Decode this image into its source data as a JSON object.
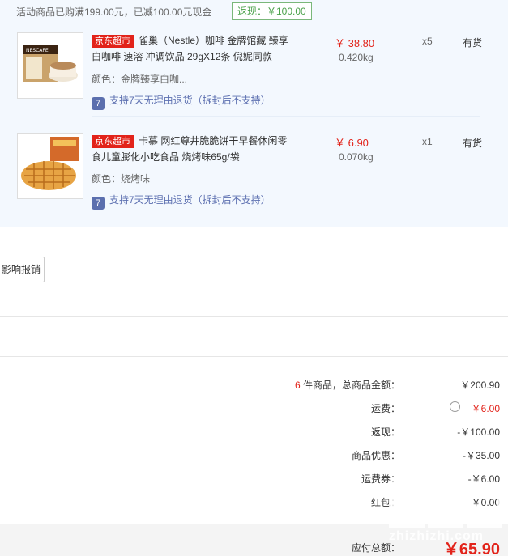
{
  "promo": {
    "text": "活动商品已购满199.00元，已减100.00元现金",
    "cashback": "返现：￥100.00"
  },
  "items": [
    {
      "shop": "京东超市",
      "title": "雀巢（Nestle）咖啡 金牌馆藏 臻享白咖啡 速溶 冲调饮品 29gX12条 倪妮同款",
      "attr": "颜色：金牌臻享白咖...",
      "return_icon": "7",
      "return_text": "支持7天无理由退货（拆封后不支持）",
      "price": "￥ 38.80",
      "weight": "0.420kg",
      "qty": "x5",
      "stock": "有货"
    },
    {
      "shop": "京东超市",
      "title": "卡慕 网红尊井脆脆饼干早餐休闲零食儿童膨化小吃食品 烧烤味65g/袋",
      "attr": "颜色：烧烤味",
      "return_icon": "7",
      "return_text": "支持7天无理由退货（拆封后不支持）",
      "price": "￥ 6.90",
      "weight": "0.070kg",
      "qty": "x1",
      "stock": "有货"
    }
  ],
  "report_button": "影响报销",
  "summary": {
    "count": "6",
    "count_label": " 件商品，总商品金额：",
    "goods_total": "￥200.90",
    "shipping_label": "运费：",
    "shipping_value": "￥6.00",
    "cashback_label": "返现：",
    "cashback_value": "-￥100.00",
    "discount_label": "商品优惠：",
    "discount_value": "-￥35.00",
    "coupon_label": "运费券：",
    "coupon_value": "-￥6.00",
    "redpacket_label": "红包：",
    "redpacket_value": "￥0.00",
    "total_label": "应付总额：",
    "total_value": "￥65.90"
  },
  "watermark": "zhizhizhi.com",
  "colors": {
    "accent_red": "#e2231a",
    "panel_bg": "#f3f8fe",
    "return_blue": "#5b6fae",
    "cashback_green": "#4aa14a"
  },
  "icons": {
    "shipping_info": "info-circle-icon",
    "return_policy": "seven-day-return-icon"
  }
}
